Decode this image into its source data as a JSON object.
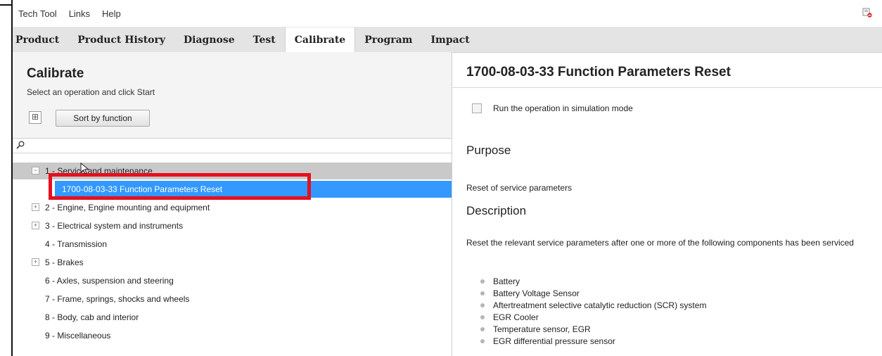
{
  "menu": [
    "Tech Tool",
    "Links",
    "Help"
  ],
  "tabs": [
    "Product",
    "Product History",
    "Diagnose",
    "Test",
    "Calibrate",
    "Program",
    "Impact"
  ],
  "left": {
    "title": "Calibrate",
    "subtitle": "Select an operation and click Start",
    "expand_label": "⊞",
    "sort_label": "Sort by function"
  },
  "tree": [
    {
      "label": "1 - Service and maintenance",
      "toggle": "−",
      "state": "selected-parent"
    },
    {
      "label": "1700-08-03-33 Function Parameters Reset",
      "toggle": "",
      "state": "selected"
    },
    {
      "label": "2 - Engine, Engine mounting and equipment",
      "toggle": "+",
      "state": ""
    },
    {
      "label": "3 - Electrical system and instruments",
      "toggle": "+",
      "state": ""
    },
    {
      "label": "4 - Transmission",
      "toggle": "",
      "state": ""
    },
    {
      "label": "5 - Brakes",
      "toggle": "+",
      "state": ""
    },
    {
      "label": "6 - Axles, suspension and steering",
      "toggle": "",
      "state": ""
    },
    {
      "label": "7 - Frame, springs, shocks and wheels",
      "toggle": "",
      "state": ""
    },
    {
      "label": "8 - Body, cab and interior",
      "toggle": "",
      "state": ""
    },
    {
      "label": "9 - Miscellaneous",
      "toggle": "",
      "state": ""
    }
  ],
  "right": {
    "title": "1700-08-03-33 Function Parameters Reset",
    "simulation_label": "Run the operation in simulation mode",
    "purpose_heading": "Purpose",
    "purpose_text": "Reset of service parameters",
    "description_heading": "Description",
    "description_text": "Reset the relevant service parameters after one or more of the following components has been serviced",
    "components": [
      "Battery",
      "Battery Voltage Sensor",
      "Aftertreatment selective catalytic reduction (SCR) system",
      "EGR Cooler",
      "Temperature sensor, EGR",
      "EGR differential pressure sensor"
    ]
  },
  "colors": {
    "selection": "#3399ff",
    "highlight": "#e5101f",
    "tabbar": "#e4e4e4"
  }
}
